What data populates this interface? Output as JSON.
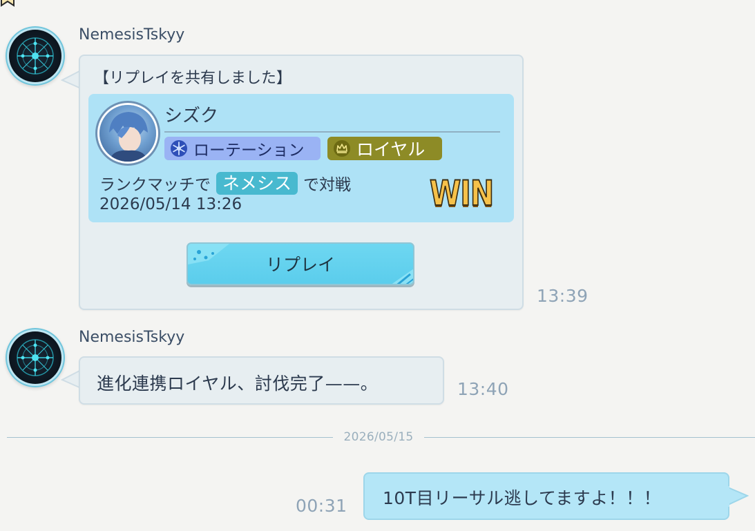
{
  "thread": {
    "messages": [
      {
        "sender": "NemesisTskyy",
        "time": "13:39",
        "replay": {
          "shared_label": "【リプレイを共有しました】",
          "player_name": "シズク",
          "format": "ローテーション",
          "format_icon": "rotation-snowflake-icon",
          "opponent_class_label": "ロイヤル",
          "class_icon": "royal-crown-icon",
          "match_prefix": "ランクマッチで",
          "played_class": "ネメシス",
          "match_suffix": "で対戦",
          "match_datetime": "2026/05/14 13:26",
          "result": "WIN",
          "button_label": "リプレイ"
        }
      },
      {
        "sender": "NemesisTskyy",
        "time": "13:40",
        "text": "進化連携ロイヤル、討伐完了——。"
      }
    ],
    "date_divider": "2026/05/15",
    "own_message": {
      "time": "00:31",
      "text": "10T目リーサル逃してますよ！！！"
    }
  },
  "colors": {
    "background": "#f4f4f2",
    "incoming_bubble": "#e7eef1",
    "outgoing_bubble": "#b4e6f7",
    "replay_card": "#aee2f6",
    "replay_button": "#5bcdec",
    "rotation_tag": "#9ab3f4",
    "royal_tag": "#8d8b26",
    "class_pill": "#48b9cf",
    "win_gold": "#f6c14a",
    "timestamp": "#8ea3b6"
  }
}
